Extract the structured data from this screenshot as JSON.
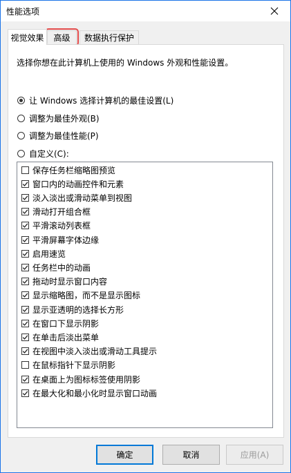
{
  "window": {
    "title": "性能选项"
  },
  "tabs": [
    {
      "label": "视觉效果",
      "active": true
    },
    {
      "label": "高级",
      "active": false
    },
    {
      "label": "数据执行保护",
      "active": false
    }
  ],
  "panel": {
    "intro": "选择你想在此计算机上使用的 Windows 外观和性能设置。",
    "options": [
      {
        "label": "让 Windows 选择计算机的最佳设置(L)",
        "selected": true
      },
      {
        "label": "调整为最佳外观(B)",
        "selected": false
      },
      {
        "label": "调整为最佳性能(P)",
        "selected": false
      },
      {
        "label": "自定义(C):",
        "selected": false
      }
    ],
    "effects": [
      {
        "label": "保存任务栏缩略图预览",
        "checked": false
      },
      {
        "label": "窗口内的动画控件和元素",
        "checked": true
      },
      {
        "label": "淡入淡出或滑动菜单到视图",
        "checked": true
      },
      {
        "label": "滑动打开组合框",
        "checked": true
      },
      {
        "label": "平滑滚动列表框",
        "checked": true
      },
      {
        "label": "平滑屏幕字体边缘",
        "checked": true
      },
      {
        "label": "启用速览",
        "checked": true
      },
      {
        "label": "任务栏中的动画",
        "checked": true
      },
      {
        "label": "拖动时显示窗口内容",
        "checked": true
      },
      {
        "label": "显示缩略图，而不是显示图标",
        "checked": true
      },
      {
        "label": "显示亚透明的选择长方形",
        "checked": true
      },
      {
        "label": "在窗口下显示阴影",
        "checked": true
      },
      {
        "label": "在单击后淡出菜单",
        "checked": true
      },
      {
        "label": "在视图中淡入淡出或滑动工具提示",
        "checked": true
      },
      {
        "label": "在鼠标指针下显示阴影",
        "checked": false
      },
      {
        "label": "在桌面上为图标标签使用阴影",
        "checked": true
      },
      {
        "label": "在最大化和最小化时显示窗口动画",
        "checked": true
      }
    ]
  },
  "buttons": {
    "ok": "确定",
    "cancel": "取消",
    "apply": "应用(A)"
  },
  "icons": {
    "close": "close-icon",
    "check": "check-icon"
  }
}
